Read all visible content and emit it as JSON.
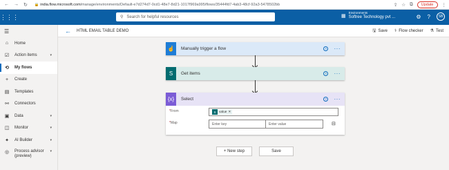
{
  "browser": {
    "url_host": "india.flow.microsoft.com",
    "url_path": "/manage/environments/Default-e7d274d7-0cd1-48e7-8d21-1017f969a995/flows/35444fd7-4ab3-48cf-92a3-5478502bb",
    "update_label": "Update"
  },
  "topbar": {
    "search_placeholder": "Search for helpful resources",
    "env_label": "Environments",
    "env_value": "Softree Technology pvt ...",
    "avatar": "SB"
  },
  "sidebar": {
    "items": [
      {
        "label": "Home",
        "icon": "home-icon"
      },
      {
        "label": "Action items",
        "icon": "action-items-icon"
      },
      {
        "label": "My flows",
        "icon": "my-flows-icon"
      },
      {
        "label": "Create",
        "icon": "plus-icon"
      },
      {
        "label": "Templates",
        "icon": "templates-icon"
      },
      {
        "label": "Connectors",
        "icon": "connectors-icon"
      },
      {
        "label": "Data",
        "icon": "data-icon"
      },
      {
        "label": "Monitor",
        "icon": "monitor-icon"
      },
      {
        "label": "AI Builder",
        "icon": "ai-builder-icon"
      },
      {
        "label": "Process advisor (preview)",
        "icon": "process-advisor-icon"
      }
    ]
  },
  "cmdbar": {
    "flow_name": "HTML EMAIL TABLE DEMO",
    "save": "Save",
    "flow_checker": "Flow checker",
    "test": "Test"
  },
  "flow": {
    "steps": [
      {
        "title": "Manually trigger a flow"
      },
      {
        "title": "Get items"
      },
      {
        "title": "Select"
      }
    ],
    "select": {
      "from_label": "From",
      "from_token": "value",
      "map_label": "Map",
      "key_placeholder": "Enter key",
      "value_placeholder": "Enter value"
    }
  },
  "buttons": {
    "new_step": "+ New step",
    "save": "Save"
  },
  "colors": {
    "topbar": "#0b5fa5",
    "trigger": "#1e7dd6",
    "sharepoint": "#036c70",
    "select": "#7b5cd6"
  }
}
